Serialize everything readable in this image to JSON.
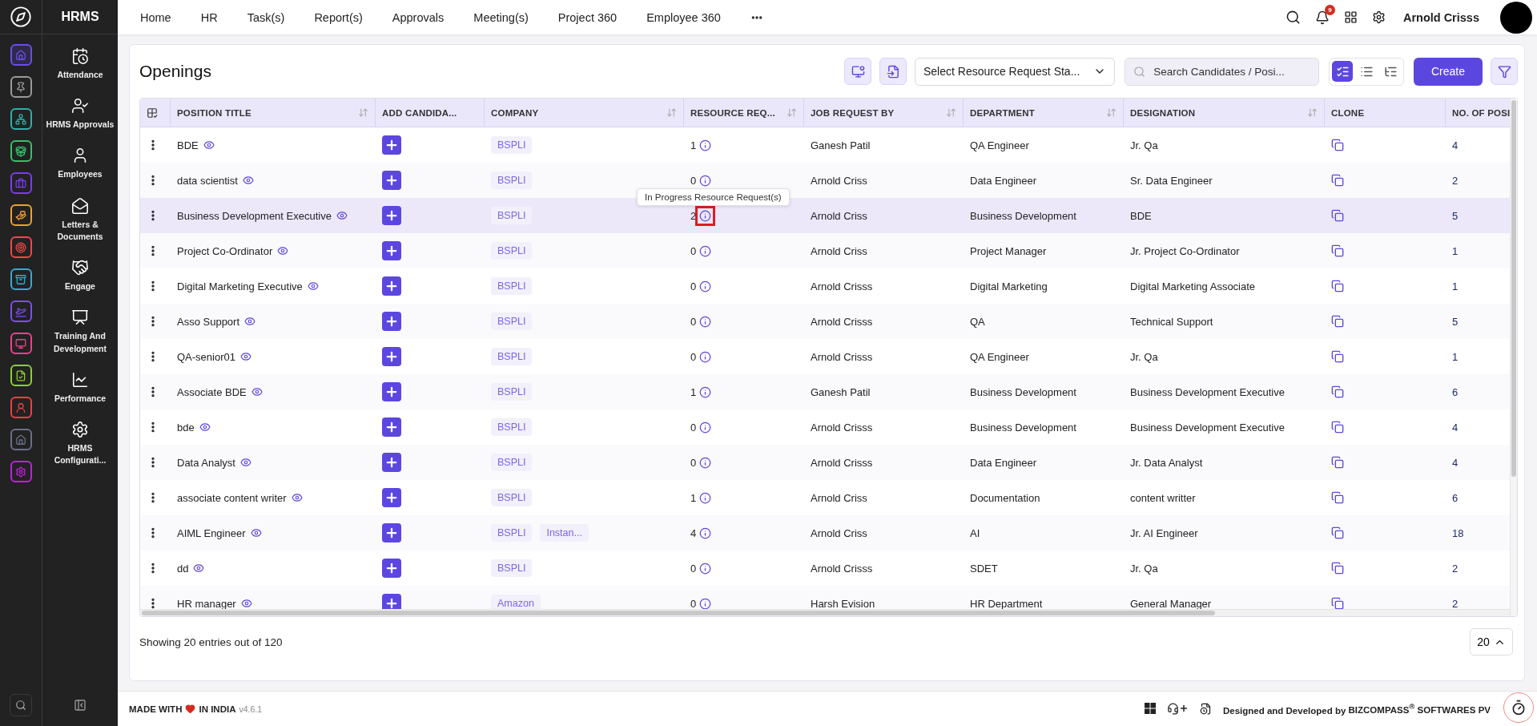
{
  "app": {
    "title": "HRMS"
  },
  "rail": [
    {
      "color": "#6c4ee8",
      "selected": true
    },
    {
      "color": "#9a9a9a",
      "selected": false
    },
    {
      "color": "#2bb3a8",
      "selected": false
    },
    {
      "color": "#36c26a",
      "selected": false
    },
    {
      "color": "#7b3cf0",
      "selected": false
    },
    {
      "color": "#f0a030",
      "selected": false
    },
    {
      "color": "#f04848",
      "selected": false
    },
    {
      "color": "#38a8d8",
      "selected": false
    },
    {
      "color": "#7c50f0",
      "selected": false
    },
    {
      "color": "#f0408c",
      "selected": false
    },
    {
      "color": "#8cd030",
      "selected": false
    },
    {
      "color": "#f04040",
      "selected": false
    },
    {
      "color": "#6a7088",
      "selected": false
    },
    {
      "color": "#c020e0",
      "selected": false
    }
  ],
  "sidebar": {
    "items": [
      {
        "label": "Attendance"
      },
      {
        "label": "HRMS Approvals"
      },
      {
        "label": "Employees"
      },
      {
        "label": "Letters & Documents"
      },
      {
        "label": "Engage"
      },
      {
        "label": "Training And Development"
      },
      {
        "label": "Performance"
      },
      {
        "label": "HRMS Configurati..."
      }
    ]
  },
  "nav": {
    "items": [
      "Home",
      "HR",
      "Task(s)",
      "Report(s)",
      "Approvals",
      "Meeting(s)",
      "Project 360",
      "Employee 360"
    ],
    "notifications": "9",
    "user": "Arnold Crisss"
  },
  "page": {
    "title": "Openings",
    "status_select": "Select Resource Request Sta...",
    "search": {
      "placeholder": "Search Candidates / Posi..."
    },
    "views": [
      {
        "selected": true
      },
      {
        "selected": false
      },
      {
        "selected": false
      }
    ],
    "create": "Create"
  },
  "table": {
    "columns": [
      {
        "label": "POSITION TITLE",
        "sortable": true
      },
      {
        "label": "ADD CANDIDA...",
        "sortable": false
      },
      {
        "label": "COMPANY",
        "sortable": true
      },
      {
        "label": "RESOURCE REQ...",
        "sortable": true
      },
      {
        "label": "JOB REQUEST BY",
        "sortable": true
      },
      {
        "label": "DEPARTMENT",
        "sortable": true
      },
      {
        "label": "DESIGNATION",
        "sortable": true
      },
      {
        "label": "CLONE",
        "sortable": false
      },
      {
        "label": "NO. OF POSI",
        "sortable": false
      }
    ],
    "rows": [
      {
        "title": "BDE",
        "companies": [
          "BSPLI"
        ],
        "resource_requests": "1",
        "hovered": false,
        "job_request_by": "Ganesh Patil",
        "department": "QA Engineer",
        "designation": "Jr. Qa",
        "positions": "4"
      },
      {
        "title": "data scientist",
        "companies": [
          "BSPLI"
        ],
        "resource_requests": "0",
        "hovered": false,
        "job_request_by": "Arnold Criss",
        "department": "Data Engineer",
        "designation": "Sr. Data Engineer",
        "positions": "2"
      },
      {
        "title": "Business Development Executive",
        "companies": [
          "BSPLI"
        ],
        "resource_requests": "2",
        "hovered": true,
        "tooltip": "In Progress Resource Request(s)",
        "job_request_by": "Arnold Criss",
        "department": "Business Development",
        "designation": "BDE",
        "positions": "5"
      },
      {
        "title": "Project Co-Ordinator",
        "companies": [
          "BSPLI"
        ],
        "resource_requests": "0",
        "hovered": false,
        "job_request_by": "Arnold Criss",
        "department": "Project Manager",
        "designation": "Jr. Project Co-Ordinator",
        "positions": "1"
      },
      {
        "title": "Digital Marketing Executive",
        "companies": [
          "BSPLI"
        ],
        "resource_requests": "0",
        "hovered": false,
        "job_request_by": "Arnold Crisss",
        "department": "Digital Marketing",
        "designation": "Digital Marketing Associate",
        "positions": "1"
      },
      {
        "title": "Asso Support",
        "companies": [
          "BSPLI"
        ],
        "resource_requests": "0",
        "hovered": false,
        "job_request_by": "Arnold Crisss",
        "department": "QA",
        "designation": "Technical Support",
        "positions": "5"
      },
      {
        "title": "QA-senior01",
        "companies": [
          "BSPLI"
        ],
        "resource_requests": "0",
        "hovered": false,
        "job_request_by": "Arnold Crisss",
        "department": "QA Engineer",
        "designation": "Jr. Qa",
        "positions": "1"
      },
      {
        "title": "Associate BDE",
        "companies": [
          "BSPLI"
        ],
        "resource_requests": "1",
        "hovered": false,
        "job_request_by": "Ganesh Patil",
        "department": "Business Development",
        "designation": "Business Development Executive",
        "positions": "6"
      },
      {
        "title": "bde",
        "companies": [
          "BSPLI"
        ],
        "resource_requests": "0",
        "hovered": false,
        "job_request_by": "Arnold Crisss",
        "department": "Business Development",
        "designation": "Business Development Executive",
        "positions": "4"
      },
      {
        "title": "Data Analyst",
        "companies": [
          "BSPLI"
        ],
        "resource_requests": "0",
        "hovered": false,
        "job_request_by": "Arnold Crisss",
        "department": "Data Engineer",
        "designation": "Jr. Data Analyst",
        "positions": "4"
      },
      {
        "title": "associate content writer",
        "companies": [
          "BSPLI"
        ],
        "resource_requests": "1",
        "hovered": false,
        "job_request_by": "Arnold Criss",
        "department": "Documentation",
        "designation": "content writter",
        "positions": "6"
      },
      {
        "title": "AIML Engineer",
        "companies": [
          "BSPLI",
          "Instan..."
        ],
        "resource_requests": "4",
        "hovered": false,
        "job_request_by": "Arnold Criss",
        "department": "AI",
        "designation": "Jr. AI Engineer",
        "positions": "18"
      },
      {
        "title": "dd",
        "companies": [
          "BSPLI"
        ],
        "resource_requests": "0",
        "hovered": false,
        "job_request_by": "Arnold Crisss",
        "department": "SDET",
        "designation": "Jr. Qa",
        "positions": "2"
      },
      {
        "title": "HR manager",
        "companies": [
          "Amazon"
        ],
        "resource_requests": "0",
        "hovered": false,
        "job_request_by": "Harsh Evision",
        "department": "HR Department",
        "designation": "General Manager",
        "positions": "2"
      }
    ]
  },
  "pagination": {
    "summary": "Showing 20 entries out of 120",
    "page_size": "20"
  },
  "footer": {
    "made_with": "MADE WITH",
    "made_in": "IN INDIA",
    "version": "v4.6.1",
    "credit": "Designed and Developed by",
    "company": "BIZCOMPASS$^{®}$ SOFTWARES PV"
  }
}
